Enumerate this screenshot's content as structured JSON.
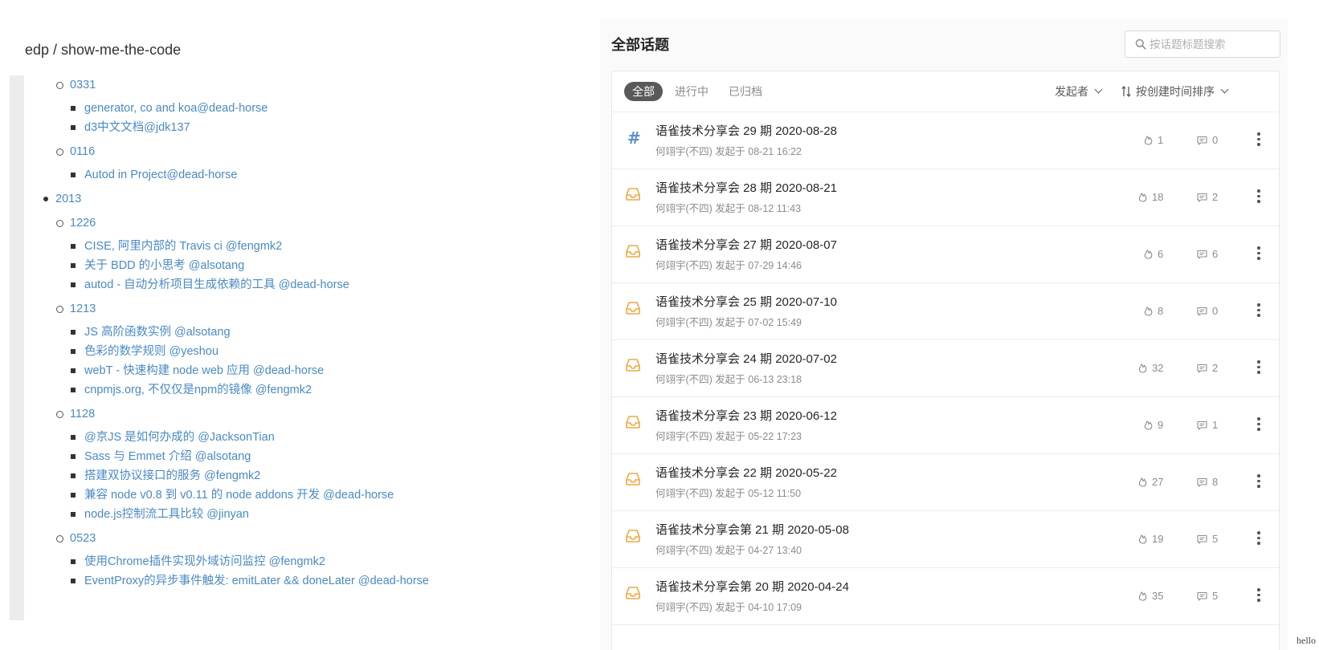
{
  "left": {
    "repo_title": "edp / show-me-the-code",
    "tree": [
      {
        "kind": "circle",
        "label": "0331"
      },
      {
        "kind": "square",
        "text": "generator, co and koa",
        "author": "@dead-horse"
      },
      {
        "kind": "square",
        "text": "d3中文文档",
        "author": "@jdk137"
      },
      {
        "kind": "circle",
        "label": "0116"
      },
      {
        "kind": "square",
        "text": "Autod in Project",
        "author": "@dead-horse"
      },
      {
        "kind": "disc",
        "label": "2013"
      },
      {
        "kind": "circle",
        "label": "1226"
      },
      {
        "kind": "square",
        "text": "CISE, 阿里内部的 Travis ci",
        "author": " @fengmk2"
      },
      {
        "kind": "square",
        "text": "关于 BDD 的小思考",
        "author": " @alsotang"
      },
      {
        "kind": "square",
        "text": "autod - 自动分析项目生成依赖的工具",
        "author": " @dead-horse"
      },
      {
        "kind": "circle",
        "label": "1213"
      },
      {
        "kind": "square",
        "text": "JS 高阶函数实例",
        "author": " @alsotang"
      },
      {
        "kind": "square",
        "text": "色彩的数学规则",
        "author": " @yeshou"
      },
      {
        "kind": "square",
        "text": "webT - 快速构建 node web 应用",
        "author": " @dead-horse"
      },
      {
        "kind": "square",
        "text": "cnpmjs.org, 不仅仅是npm的镜像",
        "author": " @fengmk2"
      },
      {
        "kind": "circle",
        "label": "1128"
      },
      {
        "kind": "square",
        "text": "@京JS 是如何办成的",
        "author": " @JacksonTian"
      },
      {
        "kind": "square",
        "text": "Sass 与 Emmet 介绍",
        "author": " @alsotang"
      },
      {
        "kind": "square",
        "text": "搭建双协议接口的服务",
        "author": " @fengmk2"
      },
      {
        "kind": "square",
        "text": "兼容 node v0.8 到 v0.11 的 node addons 开发",
        "author": " @dead-horse"
      },
      {
        "kind": "square",
        "text": "node.js控制流工具比较",
        "author": " @jinyan"
      },
      {
        "kind": "circle",
        "label": "0523"
      },
      {
        "kind": "square",
        "text": "使用Chrome插件实现外域访问监控",
        "author": " @fengmk2"
      },
      {
        "kind": "square",
        "text": "EventProxy的异步事件触发: emitLater && doneLater",
        "author": " @dead-horse"
      }
    ]
  },
  "right": {
    "heading": "全部话题",
    "search_placeholder": "按话题标题搜索",
    "tabs": [
      "全部",
      "进行中",
      "已归档"
    ],
    "filter_initiator": "发起者",
    "filter_sort": "按创建时间排序",
    "topics": [
      {
        "icon": "hash",
        "title": "语雀技术分享会 29 期 2020-08-28",
        "meta": "何翊宇(不四) 发起于 08-21 16:22",
        "likes": "1",
        "comments": "0"
      },
      {
        "icon": "inbox",
        "title": "语雀技术分享会 28 期 2020-08-21",
        "meta": "何翊宇(不四) 发起于 08-12 11:43",
        "likes": "18",
        "comments": "2"
      },
      {
        "icon": "inbox",
        "title": "语雀技术分享会 27 期 2020-08-07",
        "meta": "何翊宇(不四) 发起于 07-29 14:46",
        "likes": "6",
        "comments": "6"
      },
      {
        "icon": "inbox",
        "title": "语雀技术分享会 25 期 2020-07-10",
        "meta": "何翊宇(不四) 发起于 07-02 15:49",
        "likes": "8",
        "comments": "0"
      },
      {
        "icon": "inbox",
        "title": "语雀技术分享会 24 期 2020-07-02",
        "meta": "何翊宇(不四) 发起于 06-13 23:18",
        "likes": "32",
        "comments": "2"
      },
      {
        "icon": "inbox",
        "title": "语雀技术分享会 23 期 2020-06-12",
        "meta": "何翊宇(不四) 发起于 05-22 17:23",
        "likes": "9",
        "comments": "1"
      },
      {
        "icon": "inbox",
        "title": "语雀技术分享会 22 期 2020-05-22",
        "meta": "何翊宇(不四) 发起于 05-12 11:50",
        "likes": "27",
        "comments": "8"
      },
      {
        "icon": "inbox",
        "title": "语雀技术分享会第 21 期 2020-05-08",
        "meta": "何翊宇(不四) 发起于 04-27 13:40",
        "likes": "19",
        "comments": "5"
      },
      {
        "icon": "inbox",
        "title": "语雀技术分享会第 20 期 2020-04-24",
        "meta": "何翊宇(不四) 发起于 04-10 17:09",
        "likes": "35",
        "comments": "5"
      }
    ]
  },
  "colors": {
    "link": "#4a8ac3",
    "inbox_icon": "#f0a742",
    "hash_icon": "#5c8fcf"
  },
  "watermark": "hello"
}
